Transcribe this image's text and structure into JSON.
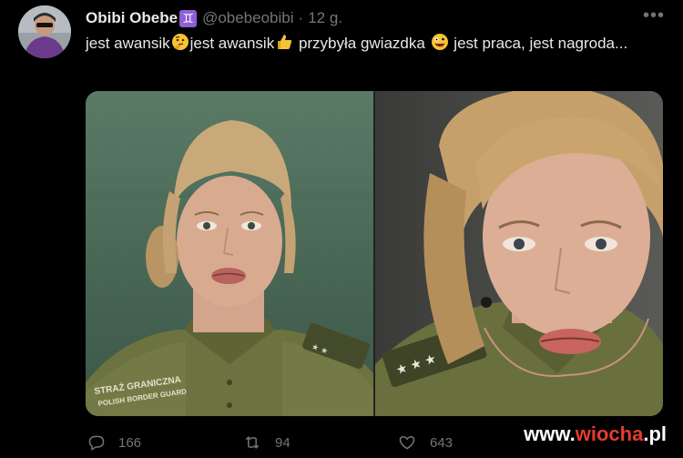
{
  "tweet": {
    "author_name": "Obibi Obebe",
    "author_badge": "♊",
    "handle": "@obebeobibi",
    "separator": "·",
    "time": "12 g.",
    "more": "•••",
    "text_parts": [
      "jest awansik",
      "jest awansik",
      " przybyła gwiazdka",
      " jest praca, jest nagroda..."
    ],
    "emojis": [
      "thinking-face-icon",
      "thumbs-up-icon",
      "zany-face-icon"
    ]
  },
  "media": {
    "left_photo_uniform_text": "STRAŻ GRANICZNA",
    "left_photo_uniform_subtext": "POLISH BORDER GUARD"
  },
  "actions": {
    "reply_count": "166",
    "retweet_count": "94",
    "like_count": "643"
  },
  "watermark": {
    "prefix": "www.",
    "brand": "wiocha",
    "suffix": ".pl"
  },
  "colors": {
    "background": "#000000",
    "text_primary": "#e7e9ea",
    "text_secondary": "#71767b",
    "watermark_accent": "#e43c2f"
  }
}
